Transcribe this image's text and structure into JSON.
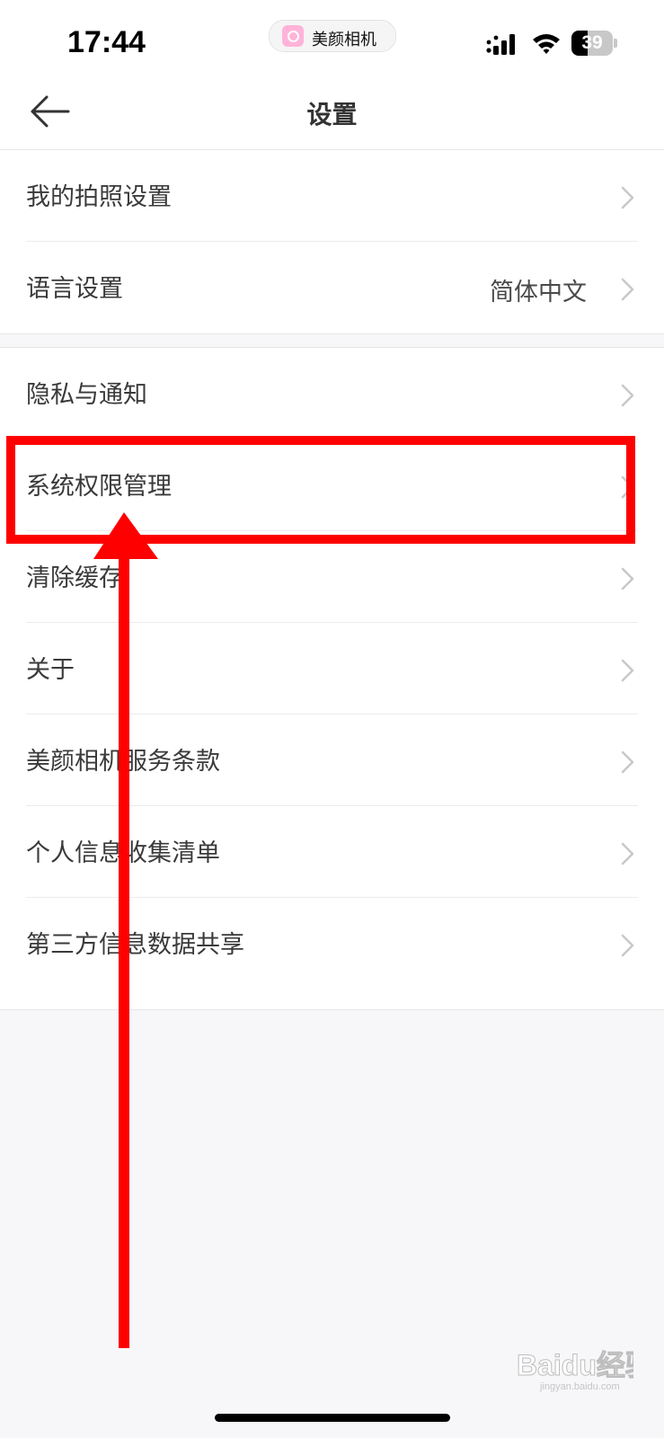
{
  "status_bar": {
    "time": "17:44",
    "app_pill_label": "美颜相机",
    "battery_level": "39",
    "battery_fraction": 0.39,
    "icons": [
      "signal-icon",
      "wifi-icon",
      "battery-icon"
    ]
  },
  "nav": {
    "title": "设置",
    "back_icon": "back-arrow-icon"
  },
  "groups": [
    {
      "items": [
        {
          "label": "我的拍照设置",
          "value": ""
        },
        {
          "label": "语言设置",
          "value": "简体中文"
        }
      ]
    },
    {
      "items": [
        {
          "label": "隐私与通知",
          "value": ""
        },
        {
          "label": "系统权限管理",
          "value": "",
          "highlighted": true
        },
        {
          "label": "清除缓存",
          "value": ""
        },
        {
          "label": "关于",
          "value": ""
        },
        {
          "label": "美颜相机服务条款",
          "value": ""
        },
        {
          "label": "个人信息收集清单",
          "value": ""
        },
        {
          "label": "第三方信息数据共享",
          "value": ""
        }
      ]
    }
  ],
  "annotation": {
    "color": "#ff0000",
    "highlighted_item": "系统权限管理"
  },
  "watermark": {
    "text": "Baidu经验",
    "sub": "jingyan.baidu.com"
  },
  "colors": {
    "background": "#f7f7f9",
    "text": "#3a3a3a",
    "chevron": "#c8c8c8"
  }
}
